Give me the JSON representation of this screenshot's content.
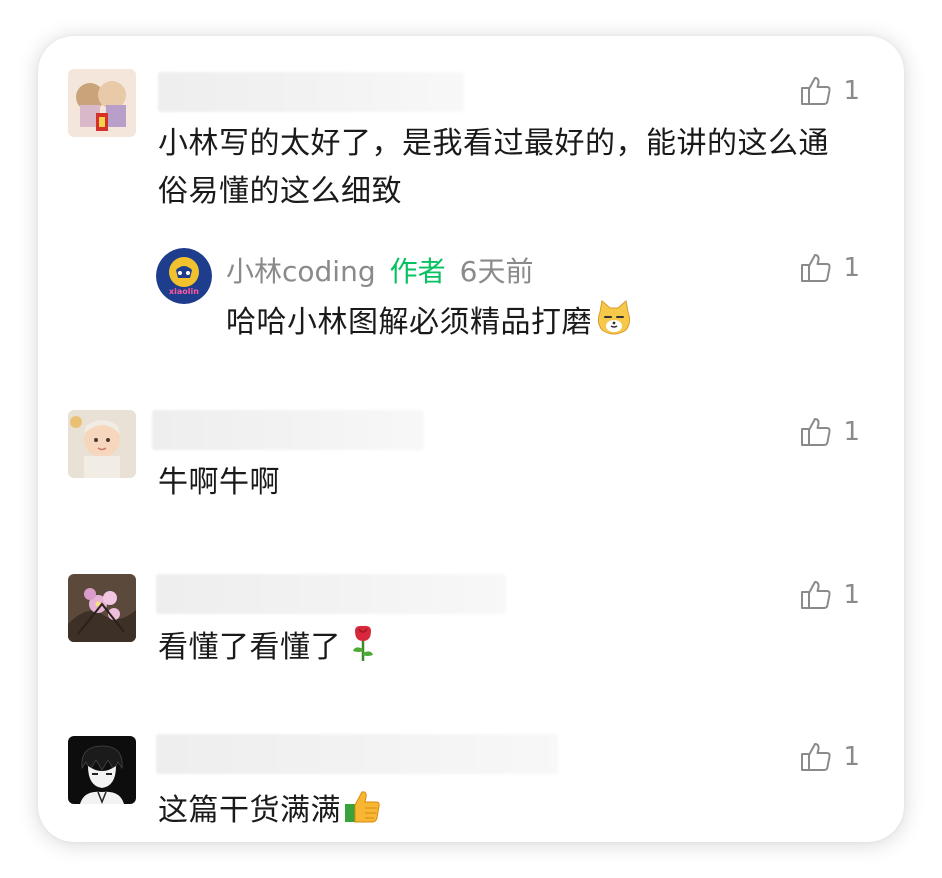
{
  "comments": [
    {
      "text": "小林写的太好了，是我看过最好的，能讲的这么通俗易懂的这么细致",
      "likes": "1",
      "reply": {
        "author": "小林coding",
        "tag": "作者",
        "time": "6天前",
        "text": "哈哈小林图解必须精品打磨",
        "emoji": "cat-face-emoji",
        "likes": "1",
        "avatar_text": "xiaolin"
      }
    },
    {
      "text": "牛啊牛啊",
      "likes": "1"
    },
    {
      "text": "看懂了看懂了",
      "emoji": "rose-emoji",
      "likes": "1"
    },
    {
      "text": "这篇干货满满",
      "emoji": "thumbs-up-emoji",
      "likes": "1"
    }
  ],
  "icons": {
    "like": "thumb-up-icon"
  },
  "colors": {
    "author_tag": "#07c160",
    "meta_gray": "#8a8a8a",
    "text": "#1a1a1a"
  }
}
